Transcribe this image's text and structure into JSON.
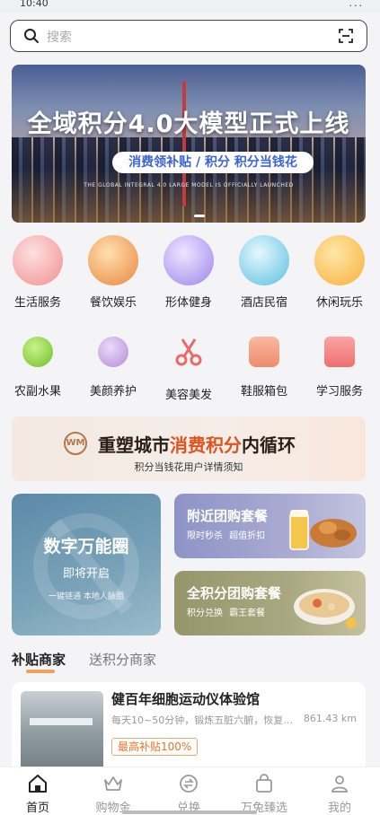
{
  "status_bar": {
    "time": "10:40",
    "right": "..."
  },
  "search": {
    "placeholder": "搜索",
    "icon": "search-icon",
    "scan_icon": "scan-icon"
  },
  "banner": {
    "title": "全域积分4.0大模型正式上线",
    "subtitle": "消费领补贴 / 积分 积分当钱花",
    "tiny": "THE GLOBAL INTEGRAL 4.0 LARGE MODEL IS OFFICIALLY LAUNCHED"
  },
  "categories": [
    {
      "label": "生活服务",
      "icon": "gift-basket-icon",
      "color": "#f3a0a0"
    },
    {
      "label": "餐饮娱乐",
      "icon": "burger-icon",
      "color": "#f6b66a"
    },
    {
      "label": "形体健身",
      "icon": "fitness-icon",
      "color": "#b6a4f0"
    },
    {
      "label": "酒店民宿",
      "icon": "hotel-icon",
      "color": "#7fd1e8"
    },
    {
      "label": "休闲玩乐",
      "icon": "fun-icon",
      "color": "#f9c25c"
    },
    {
      "label": "农副水果",
      "icon": "apple-icon",
      "color": "#8ed14a"
    },
    {
      "label": "美颜养护",
      "icon": "face-mask-icon",
      "color": "#c7a3e6"
    },
    {
      "label": "美容美发",
      "icon": "scissors-icon",
      "color": "#f08a8a"
    },
    {
      "label": "鞋服箱包",
      "icon": "bag-icon",
      "color": "#f6a48c"
    },
    {
      "label": "学习服务",
      "icon": "book-icon",
      "color": "#f58e8e"
    }
  ],
  "promo": {
    "logo": "WM",
    "title_prefix": "重塑城市",
    "title_highlight": "消费积分",
    "title_suffix": "内循环",
    "subtitle": "积分当钱花用户详情须知"
  },
  "cards": {
    "big": {
      "title": "数字万能圈",
      "status": "即将开启",
      "desc": "一键链通 本地人脉圈"
    },
    "nearby": {
      "title": "附近团购套餐",
      "sub": "限时秒杀 超值折扣"
    },
    "points": {
      "title": "全积分团购套餐",
      "sub": "积分兑换 霸王套餐"
    }
  },
  "merchant_tabs": {
    "active": "补贴商家",
    "inactive": "送积分商家"
  },
  "merchant": {
    "name": "健百年细胞运动仪体验馆",
    "desc": "每天10~50分钟，锻炼五脏六腑，恢复正常...",
    "distance": "861.43 km",
    "badge": "最高补贴100%"
  },
  "tabbar": [
    {
      "label": "首页",
      "icon": "home-icon"
    },
    {
      "label": "购物金",
      "icon": "crown-icon"
    },
    {
      "label": "兑换",
      "icon": "exchange-icon"
    },
    {
      "label": "万兔臻选",
      "icon": "shopping-bag-icon"
    },
    {
      "label": "我的",
      "icon": "user-icon"
    }
  ]
}
